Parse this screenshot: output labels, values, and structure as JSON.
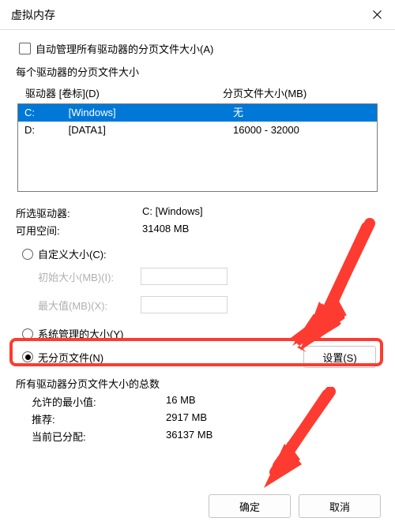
{
  "titlebar": {
    "title": "虚拟内存"
  },
  "auto_manage": {
    "label": "自动管理所有驱动器的分页文件大小(A)"
  },
  "drives_group": {
    "heading": "每个驱动器的分页文件大小",
    "header_drive": "驱动器 [卷标](D)",
    "header_size": "分页文件大小(MB)",
    "rows": [
      {
        "letter": "C:",
        "label": "[Windows]",
        "size": "无"
      },
      {
        "letter": "D:",
        "label": "[DATA1]",
        "size": "16000 - 32000"
      }
    ]
  },
  "selected": {
    "drive_label": "所选驱动器:",
    "drive_value": "C:  [Windows]",
    "space_label": "可用空间:",
    "space_value": "31408 MB"
  },
  "size_options": {
    "custom_label": "自定义大小(C):",
    "initial_label": "初始大小(MB)(I):",
    "max_label": "最大值(MB)(X):",
    "system_label": "系统管理的大小(Y)",
    "none_label": "无分页文件(N)",
    "set_button": "设置(S)"
  },
  "totals": {
    "heading": "所有驱动器分页文件大小的总数",
    "min_label": "允许的最小值:",
    "min_value": "16 MB",
    "rec_label": "推荐:",
    "rec_value": "2917 MB",
    "cur_label": "当前已分配:",
    "cur_value": "36137 MB"
  },
  "buttons": {
    "ok": "确定",
    "cancel": "取消"
  }
}
